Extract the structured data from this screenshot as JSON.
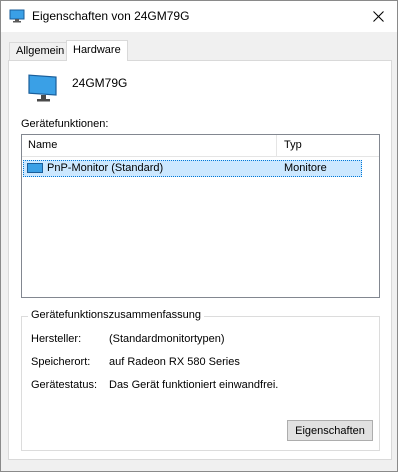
{
  "window": {
    "title": "Eigenschaften von 24GM79G",
    "close_icon": "close-icon"
  },
  "tabs": [
    {
      "label": "Allgemein",
      "active": false
    },
    {
      "label": "Hardware",
      "active": true
    }
  ],
  "device": {
    "name": "24GM79G",
    "icon": "monitor-icon"
  },
  "functions": {
    "label": "Gerätefunktionen:",
    "columns": [
      "Name",
      "Typ"
    ],
    "rows": [
      {
        "name": "PnP-Monitor (Standard)",
        "type": "Monitore",
        "selected": true
      }
    ]
  },
  "summary": {
    "legend": "Gerätefunktionszusammenfassung",
    "properties": [
      {
        "label": "Hersteller:",
        "value": "(Standardmonitortypen)"
      },
      {
        "label": "Speicherort:",
        "value": "auf Radeon RX 580 Series"
      },
      {
        "label": "Gerätestatus:",
        "value": "Das Gerät funktioniert einwandfrei."
      }
    ],
    "button_label": "Eigenschaften"
  },
  "colors": {
    "selection": "#cce8ff",
    "focus_border": "#0078d7",
    "monitor_screen": "#3aa0e6"
  }
}
